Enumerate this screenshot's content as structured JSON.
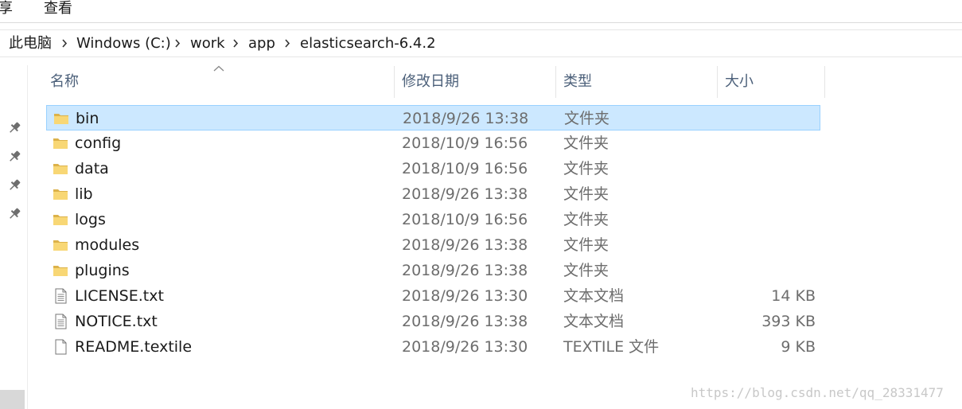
{
  "ribbon": {
    "tabs": [
      {
        "label": "享"
      },
      {
        "label": "查看"
      }
    ]
  },
  "address": {
    "crumbs": [
      "此电脑",
      "Windows (C:)",
      "work",
      "app",
      "elasticsearch-6.4.2"
    ]
  },
  "columns": {
    "name": "名称",
    "modified": "修改日期",
    "type": "类型",
    "size": "大小"
  },
  "files": [
    {
      "name": "bin",
      "modified": "2018/9/26 13:38",
      "type": "文件夹",
      "size": "",
      "icon": "folder-icon",
      "selected": true
    },
    {
      "name": "config",
      "modified": "2018/10/9 16:56",
      "type": "文件夹",
      "size": "",
      "icon": "folder-icon"
    },
    {
      "name": "data",
      "modified": "2018/10/9 16:56",
      "type": "文件夹",
      "size": "",
      "icon": "folder-icon"
    },
    {
      "name": "lib",
      "modified": "2018/9/26 13:38",
      "type": "文件夹",
      "size": "",
      "icon": "folder-icon"
    },
    {
      "name": "logs",
      "modified": "2018/10/9 16:56",
      "type": "文件夹",
      "size": "",
      "icon": "folder-icon"
    },
    {
      "name": "modules",
      "modified": "2018/9/26 13:38",
      "type": "文件夹",
      "size": "",
      "icon": "folder-icon"
    },
    {
      "name": "plugins",
      "modified": "2018/9/26 13:38",
      "type": "文件夹",
      "size": "",
      "icon": "folder-icon"
    },
    {
      "name": "LICENSE.txt",
      "modified": "2018/9/26 13:30",
      "type": "文本文档",
      "size": "14 KB",
      "icon": "text-document-icon"
    },
    {
      "name": "NOTICE.txt",
      "modified": "2018/9/26 13:38",
      "type": "文本文档",
      "size": "393 KB",
      "icon": "text-document-icon"
    },
    {
      "name": "README.textile",
      "modified": "2018/9/26 13:30",
      "type": "TEXTILE 文件",
      "size": "9 KB",
      "icon": "blank-document-icon"
    }
  ],
  "watermark": "https://blog.csdn.net/qq_28331477",
  "colors": {
    "selection_bg": "#cce8ff",
    "selection_border": "#99d1ff",
    "header_text": "#4c607a",
    "folder_yellow": "#f8d775"
  }
}
